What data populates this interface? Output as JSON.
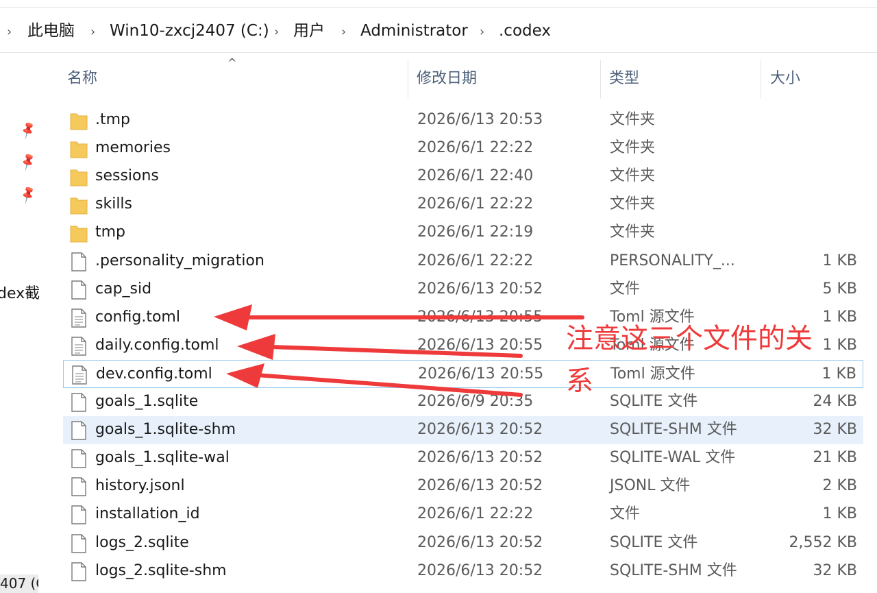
{
  "breadcrumb": {
    "separator": "›",
    "items": [
      "此电脑",
      "Win10-zxcj2407 (C:)",
      "用户",
      "Administrator",
      ".codex"
    ]
  },
  "columns": {
    "name": "名称",
    "date": "修改日期",
    "type": "类型",
    "size": "大小"
  },
  "sort_indicator": "^",
  "left_pane": {
    "label": "dex截",
    "bottom_label": "407 (C"
  },
  "files": [
    {
      "kind": "folder",
      "name": ".tmp",
      "date": "2026/6/13 20:53",
      "type": "文件夹",
      "size": ""
    },
    {
      "kind": "folder",
      "name": "memories",
      "date": "2026/6/1 22:22",
      "type": "文件夹",
      "size": ""
    },
    {
      "kind": "folder",
      "name": "sessions",
      "date": "2026/6/1 22:40",
      "type": "文件夹",
      "size": ""
    },
    {
      "kind": "folder",
      "name": "skills",
      "date": "2026/6/1 22:22",
      "type": "文件夹",
      "size": ""
    },
    {
      "kind": "folder",
      "name": "tmp",
      "date": "2026/6/1 22:19",
      "type": "文件夹",
      "size": ""
    },
    {
      "kind": "file",
      "name": ".personality_migration",
      "date": "2026/6/1 22:22",
      "type": "PERSONALITY_...",
      "size": "1 KB"
    },
    {
      "kind": "file",
      "name": "cap_sid",
      "date": "2026/6/13 20:52",
      "type": "文件",
      "size": "5 KB"
    },
    {
      "kind": "text",
      "name": "config.toml",
      "date": "2026/6/13 20:55",
      "type": "Toml 源文件",
      "size": "1 KB"
    },
    {
      "kind": "text",
      "name": "daily.config.toml",
      "date": "2026/6/13 20:55",
      "type": "Toml 源文件",
      "size": "1 KB"
    },
    {
      "kind": "text",
      "name": "dev.config.toml",
      "date": "2026/6/13 20:55",
      "type": "Toml 源文件",
      "size": "1 KB"
    },
    {
      "kind": "file",
      "name": "goals_1.sqlite",
      "date": "2026/6/9 20:35",
      "type": "SQLITE 文件",
      "size": "24 KB"
    },
    {
      "kind": "file",
      "name": "goals_1.sqlite-shm",
      "date": "2026/6/13 20:52",
      "type": "SQLITE-SHM 文件",
      "size": "32 KB"
    },
    {
      "kind": "file",
      "name": "goals_1.sqlite-wal",
      "date": "2026/6/13 20:52",
      "type": "SQLITE-WAL 文件",
      "size": "21 KB"
    },
    {
      "kind": "file",
      "name": "history.jsonl",
      "date": "2026/6/13 20:52",
      "type": "JSONL 文件",
      "size": "2 KB"
    },
    {
      "kind": "file",
      "name": "installation_id",
      "date": "2026/6/1 22:22",
      "type": "文件",
      "size": "1 KB"
    },
    {
      "kind": "file",
      "name": "logs_2.sqlite",
      "date": "2026/6/13 20:52",
      "type": "SQLITE 文件",
      "size": "2,552 KB"
    },
    {
      "kind": "file",
      "name": "logs_2.sqlite-shm",
      "date": "2026/6/13 20:52",
      "type": "SQLITE-SHM 文件",
      "size": "32 KB"
    }
  ],
  "selected_index": 11,
  "focused_index": 9,
  "annotation": {
    "line1": "注意这三个文件的关",
    "line2": "系",
    "color": "#ee3a3a"
  },
  "colors": {
    "folder": "#f5c95c",
    "selected": "#e8f1fb",
    "header_text": "#4c607a"
  }
}
